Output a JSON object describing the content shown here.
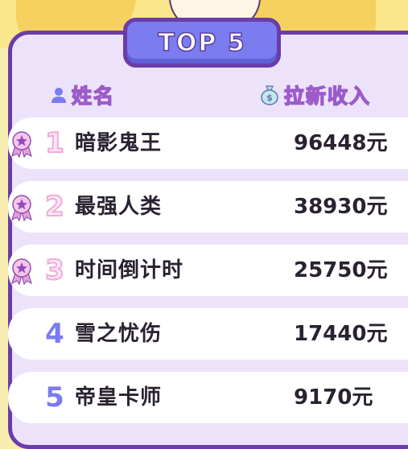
{
  "title": "TOP 5",
  "header": {
    "name_label": "姓名",
    "income_label": "拉新收入"
  },
  "colors": {
    "board_bg": "#ece3fb",
    "board_border": "#6b3ca8",
    "badge_bg": "#7b7cf0",
    "header_text": "#f8c3ee",
    "rank_top3": "#f4a9d9",
    "rank_other": "#7b7cf0",
    "medal": "#e79fd4"
  },
  "rows": [
    {
      "rank": "1",
      "name": "暗影鬼王",
      "amount": "96448元",
      "medal": true
    },
    {
      "rank": "2",
      "name": "最强人类",
      "amount": "38930元",
      "medal": true
    },
    {
      "rank": "3",
      "name": "时间倒计时",
      "amount": "25750元",
      "medal": true
    },
    {
      "rank": "4",
      "name": "雪之忧伤",
      "amount": "17440元",
      "medal": false
    },
    {
      "rank": "5",
      "name": "帝皇卡师",
      "amount": "9170元",
      "medal": false
    }
  ]
}
